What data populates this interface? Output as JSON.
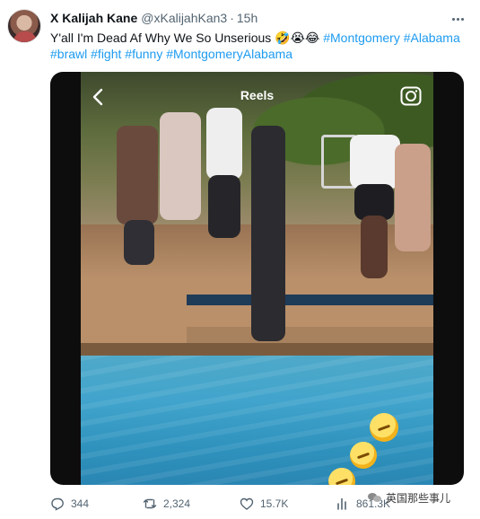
{
  "tweet": {
    "author_name": "X Kalijah Kane",
    "author_handle": "@xKalijahKan3",
    "separator": "·",
    "time": "15h",
    "text_plain": "Y'all I'm Dead Af Why We So Unserious",
    "emojis": "🤣😭😂",
    "hashtags": [
      "#Montgomery",
      "#Alabama",
      "#brawl",
      "#fight",
      "#funny",
      "#MontgomeryAlabama"
    ]
  },
  "media": {
    "overlay_title": "Reels",
    "back_icon": "chevron-left-icon",
    "camera_icon": "camera-icon",
    "overlay_emoji": "laughing-emoji"
  },
  "actions": {
    "reply_count": "344",
    "retweet_count": "2,324",
    "like_count": "15.7K",
    "views_count": "861.3K"
  },
  "watermark": {
    "text": "英国那些事儿"
  },
  "colors": {
    "link": "#1d9bf0",
    "secondary_text": "#536471",
    "primary_text": "#0f1419"
  }
}
